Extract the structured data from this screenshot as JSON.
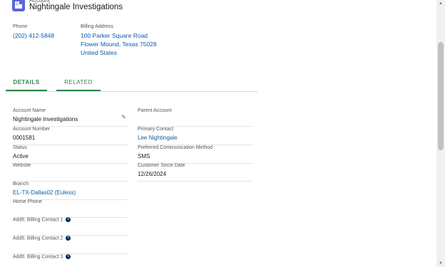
{
  "header": {
    "object_type": "Account",
    "title": "Nightingale Investigations",
    "icon": "account-icon",
    "accent_color": "#5a67d8"
  },
  "highlights": {
    "phone_label": "Phone",
    "phone_value": "(202) 412-5848",
    "billing_label": "Billing Address",
    "billing_line1": "100 Parker Square Road",
    "billing_line2": "Flower Mound, Texas 75028",
    "billing_line3": "United States"
  },
  "tabs": [
    {
      "label": "DETAILS",
      "active": true
    },
    {
      "label": "RELATED",
      "active": false
    }
  ],
  "fields_left": [
    {
      "label": "Account Name",
      "value": "Nightingale Investigations"
    },
    {
      "label": "Account Number",
      "value": "0001581"
    },
    {
      "label": "Status",
      "value": "Active"
    },
    {
      "label": "Website",
      "value": ""
    },
    {
      "label": "Branch",
      "value": "EL-TX-Dallas02 (Euless)"
    },
    {
      "label": "Home Phone",
      "value": ""
    },
    {
      "label": "Addtl. Billing Contact 1",
      "value": ""
    },
    {
      "label": "Addtl. Billing Contact 2",
      "value": ""
    },
    {
      "label": "Addtl. Billing Contact 3",
      "value": ""
    }
  ],
  "fields_right": [
    {
      "label": "Parent Account",
      "value": ""
    },
    {
      "label": "Primary Contact",
      "value": "Lee Nightingale"
    },
    {
      "label": "Preferred Communication Method",
      "value": "SMS"
    },
    {
      "label": "Customer Since Date",
      "value": "12/26/2024"
    }
  ],
  "info_icon": "i"
}
